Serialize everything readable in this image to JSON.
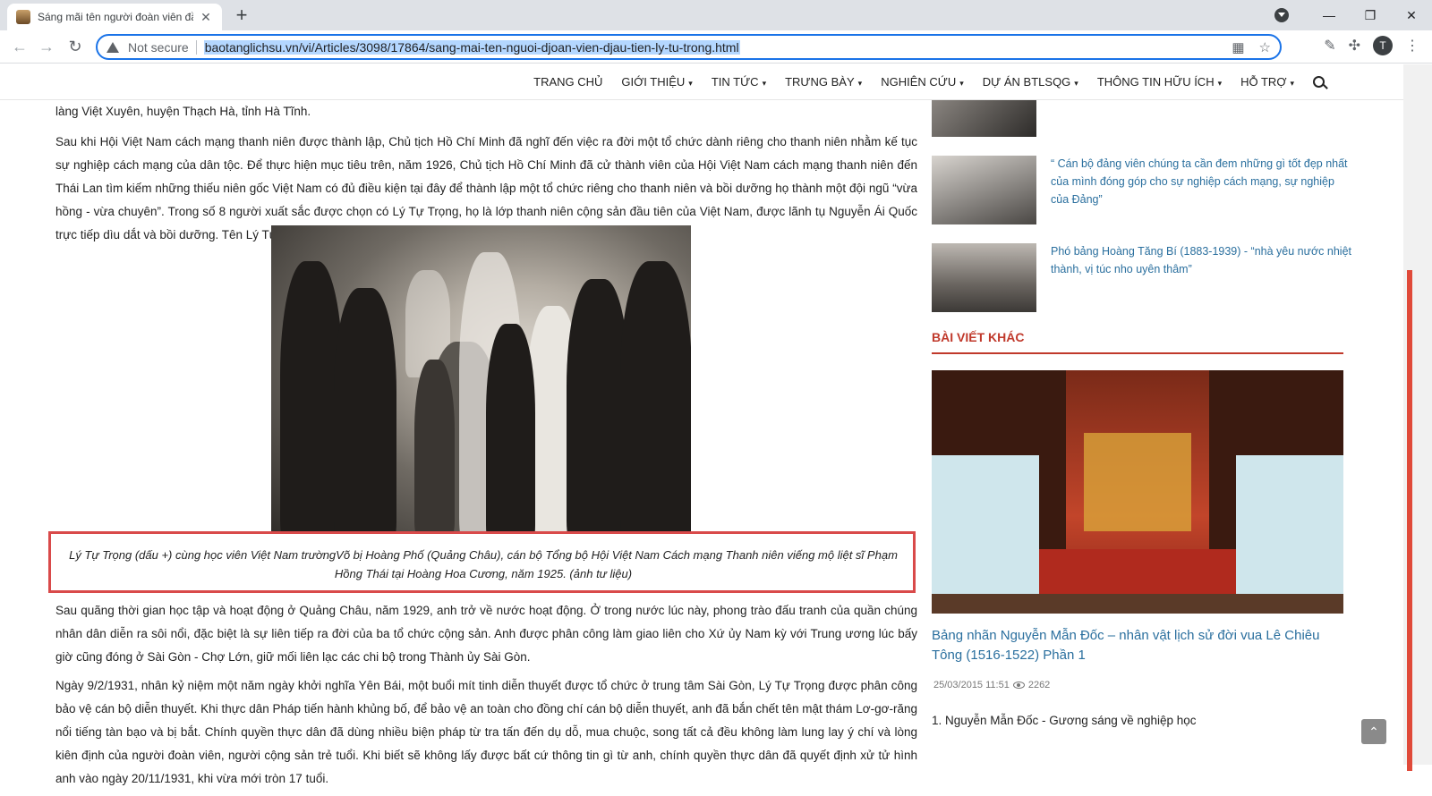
{
  "browser": {
    "tab_title": "Sáng mãi tên người đoàn viên đầ",
    "tab_close": "✕",
    "new_tab": "+",
    "not_secure": "Not secure",
    "url": "baotanglichsu.vn/vi/Articles/3098/17864/sang-mai-ten-nguoi-djoan-vien-djau-tien-ly-tu-trong.html",
    "avatar_letter": "T",
    "back": "←",
    "forward": "→",
    "reload": "↻",
    "minimize": "—",
    "restore": "❐",
    "close": "✕"
  },
  "nav": {
    "items": [
      {
        "label": "TRANG CHỦ",
        "caret": ""
      },
      {
        "label": "GIỚI THIỆU",
        "caret": "▾"
      },
      {
        "label": "TIN TỨC",
        "caret": "▾"
      },
      {
        "label": "TRƯNG BÀY",
        "caret": "▾"
      },
      {
        "label": "NGHIÊN CỨU",
        "caret": "▾"
      },
      {
        "label": "DỰ ÁN BTLSQG",
        "caret": "▾"
      },
      {
        "label": "THÔNG TIN HỮU ÍCH",
        "caret": "▾"
      },
      {
        "label": "HỖ TRỢ",
        "caret": "▾"
      }
    ]
  },
  "article": {
    "p0": "làng Việt Xuyên, huyện Thạch Hà, tỉnh Hà Tĩnh.",
    "p1": "Sau khi Hội Việt Nam cách mạng thanh niên được thành lập, Chủ tịch Hồ Chí Minh đã nghĩ đến việc ra đời một tổ chức dành riêng cho thanh niên nhằm kế tục sự nghiệp cách mạng của dân tộc. Để thực hiện mục tiêu trên, năm 1926, Chủ tịch Hồ Chí Minh đã cử thành viên của Hội Việt Nam cách mạng thanh niên đến Thái Lan tìm kiếm những thiếu niên gốc Việt Nam có đủ điều kiện tại đây để thành lập một tổ chức riêng cho thanh niên và bồi dưỡng họ thành một đội ngũ “vừa hồng - vừa chuyên”. Trong số 8 người xuất sắc được chọn có Lý Tự Trọng, họ là lớp thanh niên cộng sản đầu tiên của Việt Nam, được lãnh tụ Nguyễn Ái Quốc trực tiếp dìu dắt và bồi dưỡng. Tên Lý Tự Trọng cũng được xuất hiện từ đây.",
    "caption": "Lý Tự Trọng (dấu +) cùng học viên Việt Nam trườngVõ bị Hoàng Phố (Quảng Châu), cán bộ Tổng bộ Hội Việt Nam Cách mạng Thanh niên viếng mộ liệt sĩ Phạm Hồng Thái tại Hoàng Hoa Cương, năm 1925. (ảnh tư liệu)",
    "p2": "Sau quãng thời gian học tập và hoạt động ở Quảng Châu, năm 1929, anh trở về nước hoạt động. Ở trong nước lúc này, phong trào đấu tranh của quần chúng nhân dân diễn ra sôi nổi, đặc biệt là sự liên tiếp ra đời của ba tổ chức cộng sản. Anh được phân công làm giao liên cho Xứ ủy Nam kỳ với Trung ương lúc bấy giờ cũng đóng ở Sài Gòn - Chợ Lớn, giữ mối liên lạc các chi bộ trong Thành ủy Sài Gòn.",
    "p3": "Ngày 9/2/1931, nhân kỷ niệm một năm ngày khởi nghĩa Yên Bái, một buổi mít tinh diễn thuyết được tổ chức ở trung tâm Sài Gòn, Lý Tự Trọng được phân công bảo vệ cán bộ diễn thuyết. Khi thực dân Pháp tiến hành khủng bố, để bảo vệ an toàn cho đồng chí cán bộ diễn thuyết, anh đã bắn chết tên mật thám Lơ-gơ-răng nổi tiếng tàn bạo và bị bắt. Chính quyền thực dân đã dùng nhiều biện pháp từ tra tấn đến dụ dỗ, mua chuộc, song tất cả đều không làm lung lay ý chí và lòng kiên định của người đoàn viên, người cộng sản trẻ tuổi. Khi biết sẽ không lấy được bất cứ thông tin gì từ anh, chính quyền thực dân đã quyết định xử tử hình anh vào ngày 20/11/1931, khi vừa mới tròn 17 tuổi."
  },
  "sidebar": {
    "link1": "“ Cán bộ đảng viên chúng ta cần đem những gì tốt đẹp nhất của mình đóng góp cho sự nghiệp cách mạng, sự nghiệp của Đảng”",
    "link2": "Phó bảng Hoàng Tăng Bí (1883-1939) - “nhà yêu nước nhiệt thành, vị túc nho uyên thâm”",
    "heading": "BÀI VIẾT KHÁC",
    "feature_title": "Bảng nhãn Nguyễn Mẫn Đốc – nhân vật lịch sử đời vua Lê Chiêu Tông (1516-1522) Phần 1",
    "feature_date": "25/03/2015 11:51",
    "feature_views": "2262",
    "item1": "1. Nguyễn Mẫn Đốc - Gương sáng về nghiệp học"
  },
  "scroll_top": "⌃"
}
